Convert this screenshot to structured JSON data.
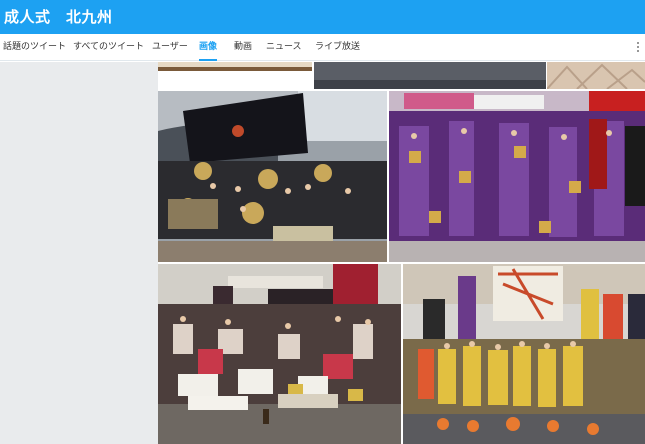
{
  "header": {
    "title": "成人式　北九州"
  },
  "tabs": [
    {
      "label": "話題のツイート",
      "active": false
    },
    {
      "label": "すべてのツイート",
      "active": false
    },
    {
      "label": "ユーザー",
      "active": false
    },
    {
      "label": "画像",
      "active": true
    },
    {
      "label": "動画",
      "active": false
    },
    {
      "label": "ニュース",
      "active": false
    },
    {
      "label": "ライブ放送",
      "active": false
    }
  ],
  "menu_icon": "more-vertical-icon",
  "colors": {
    "header": "#1da1f2",
    "accent": "#1da1f2",
    "sidebar": "#e9ebed"
  }
}
